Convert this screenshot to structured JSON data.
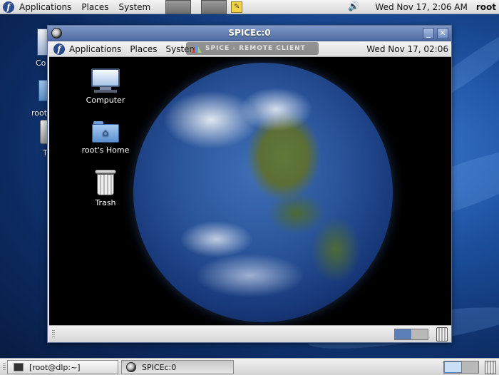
{
  "host_panel": {
    "menus": [
      "Applications",
      "Places",
      "System"
    ],
    "clock": "Wed Nov 17,  2:06 AM",
    "user": "root"
  },
  "host_desktop": {
    "icons": [
      "Co",
      "root'",
      "T"
    ]
  },
  "window": {
    "title": "SPICEc:0",
    "minimize_label": "_",
    "close_label": "✕"
  },
  "guest_panel": {
    "menus": [
      "Applications",
      "Places",
      "System"
    ],
    "overlay_text": "SPICE - REMOTE CLIENT",
    "clock": "Wed Nov 17, 02:06"
  },
  "guest_desktop": {
    "icons": [
      {
        "label": "Computer"
      },
      {
        "label": "root's Home"
      },
      {
        "label": "Trash"
      }
    ]
  },
  "host_taskbar": {
    "tasks": [
      {
        "label": "[root@dlp:~]"
      },
      {
        "label": "SPICEc:0"
      }
    ]
  },
  "colors": {
    "titlebar": "#5f7bb2",
    "desktop": "#1b4f9c",
    "workspace_active": "#5a7fb6"
  }
}
